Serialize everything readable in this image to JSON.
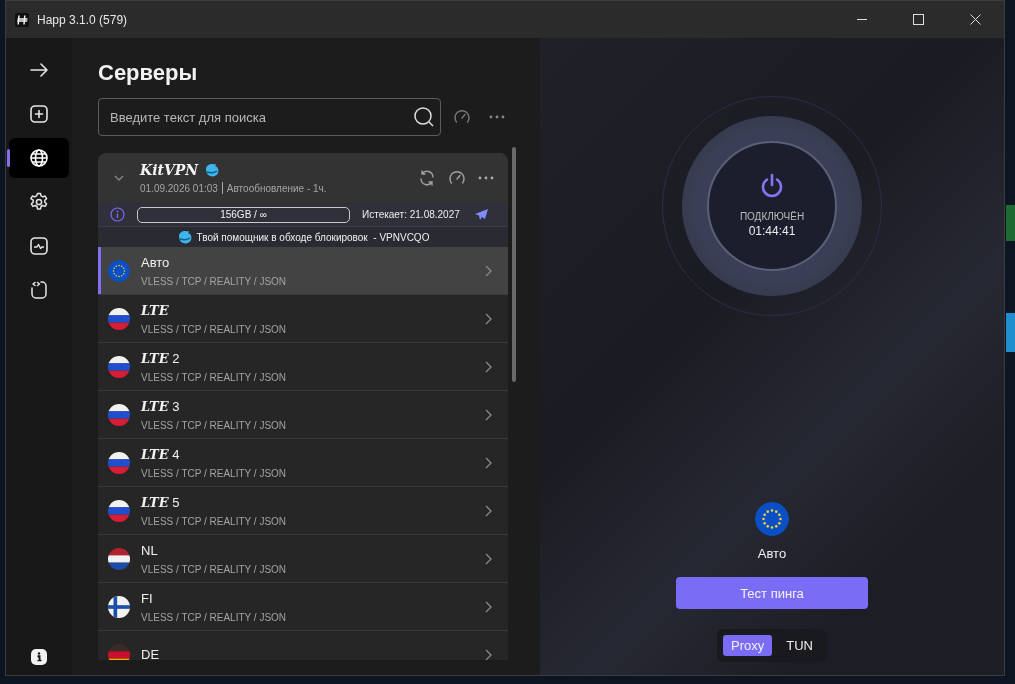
{
  "window": {
    "title": "Happ 3.1.0 (579)"
  },
  "sidebar": {
    "items": [
      {
        "kind": "arrow",
        "selected": false
      },
      {
        "kind": "add",
        "selected": false
      },
      {
        "kind": "globe",
        "selected": true
      },
      {
        "kind": "settings",
        "selected": false
      },
      {
        "kind": "chart",
        "selected": false
      },
      {
        "kind": "code",
        "selected": false
      }
    ]
  },
  "page_title": "Серверы",
  "search": {
    "placeholder": "Введите текст для поиска"
  },
  "group": {
    "name": "KitVPN",
    "expanded": true,
    "updated": "01.09.2026 01:03",
    "auto_update": "Автообновление - 1ч.",
    "traffic": "156GB / ∞",
    "expires": "Истекает: 21.08.2027",
    "announcement": "Твой помощник в обходе блокировок  - VPNVCQO"
  },
  "servers": [
    {
      "name": "Авто",
      "kind": "eu",
      "protocol": "VLESS / TCP / REALITY / JSON",
      "selected": true
    },
    {
      "name": "**LTE**",
      "kind": "ru",
      "protocol": "VLESS / TCP / REALITY / JSON",
      "selected": false
    },
    {
      "name": "**LTE** 2",
      "kind": "ru",
      "protocol": "VLESS / TCP / REALITY / JSON",
      "selected": false
    },
    {
      "name": "**LTE** 3",
      "kind": "ru",
      "protocol": "VLESS / TCP / REALITY / JSON",
      "selected": false
    },
    {
      "name": "**LTE** 4",
      "kind": "ru",
      "protocol": "VLESS / TCP / REALITY / JSON",
      "selected": false
    },
    {
      "name": "**LTE** 5",
      "kind": "ru",
      "protocol": "VLESS / TCP / REALITY / JSON",
      "selected": false
    },
    {
      "name": "NL",
      "kind": "nl",
      "protocol": "VLESS / TCP / REALITY / JSON",
      "selected": false
    },
    {
      "name": "FI",
      "kind": "fi",
      "protocol": "VLESS / TCP / REALITY / JSON",
      "selected": false
    },
    {
      "name": "DE",
      "kind": "de",
      "selected": false
    }
  ],
  "connection": {
    "status": "ПОДКЛЮЧЁН",
    "duration": "01:44:41",
    "server": "Авто",
    "server_flag": {
      "kind": "eu"
    }
  },
  "ping_button": "Тест пинга",
  "modes": [
    {
      "label": "Proxy",
      "selected": true
    },
    {
      "label": "TUN",
      "selected": false
    }
  ]
}
